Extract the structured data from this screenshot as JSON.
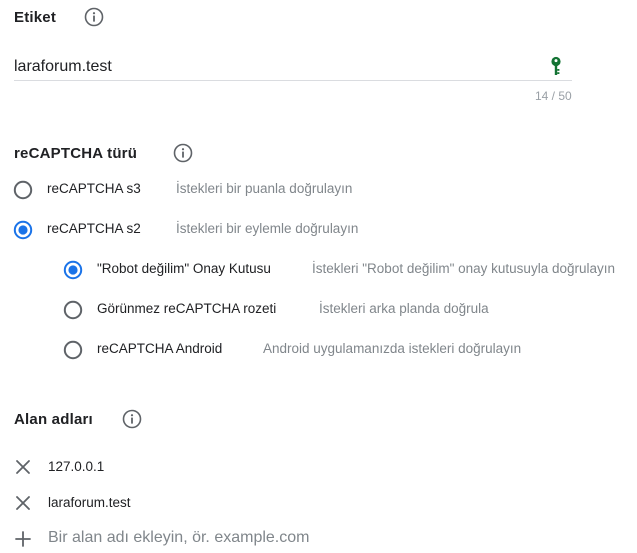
{
  "label_section": {
    "title": "Etiket",
    "value": "laraforum.test",
    "counter": "14 / 50"
  },
  "recaptcha_section": {
    "title": "reCAPTCHA türü",
    "types": [
      {
        "label": "reCAPTCHA s3",
        "desc": "İstekleri bir puanla doğrulayın",
        "selected": false
      },
      {
        "label": "reCAPTCHA s2",
        "desc": "İstekleri bir eylemle doğrulayın",
        "selected": true
      }
    ],
    "subtypes": [
      {
        "label": "\"Robot değilim\" Onay Kutusu",
        "desc": "İstekleri \"Robot değilim\" onay kutusuyla doğrulayın",
        "selected": true
      },
      {
        "label": "Görünmez reCAPTCHA rozeti",
        "desc": "İstekleri arka planda doğrula",
        "selected": false
      },
      {
        "label": "reCAPTCHA Android",
        "desc": "Android uygulamanızda istekleri doğrulayın",
        "selected": false
      }
    ]
  },
  "domains_section": {
    "title": "Alan adları",
    "domains": [
      "127.0.0.1",
      "laraforum.test"
    ],
    "add_placeholder": "Bir alan adı ekleyin, ör. example.com"
  },
  "colors": {
    "accent": "#1a73e8",
    "key_icon": "#137333",
    "radio_off": "#5f6368",
    "muted_text": "#80868b"
  }
}
